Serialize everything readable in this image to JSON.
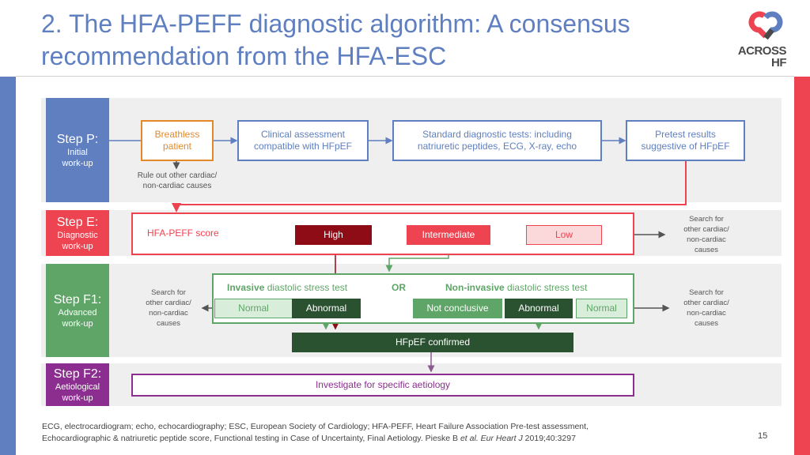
{
  "title": {
    "line1": "2. The HFA-PEFF diagnostic algorithm: A consensus",
    "line2": "recommendation from the HFA-ESC"
  },
  "logo": {
    "line1": "ACROSS",
    "line2": "HF",
    "icon": "heart-loop-logo-icon"
  },
  "colors": {
    "step_p": "#5f7fc1",
    "step_e": "#ee4350",
    "step_f1": "#5ea567",
    "step_f2": "#8b2e8f",
    "orange": "#e28a2a",
    "dark_red": "#8e0c15",
    "dark_green": "#2a5230",
    "light_green": "#d9eddb",
    "light_red": "#fbd8da"
  },
  "step_p": {
    "label": "Step P:",
    "sub1": "Initial",
    "sub2": "work-up",
    "boxes": [
      {
        "line1": "Breathless",
        "line2": "patient"
      },
      {
        "line1": "Clinical assessment",
        "line2": "compatible with HFpEF"
      },
      {
        "line1": "Standard diagnostic tests: including",
        "line2": "natriuretic peptides, ECG, X-ray, echo"
      },
      {
        "line1": "Pretest results",
        "line2": "suggestive of HFpEF"
      }
    ],
    "note_line1": "Rule out other cardiac/",
    "note_line2": "non-cardiac causes"
  },
  "step_e": {
    "label": "Step E:",
    "sub1": "Diagnostic",
    "sub2": "work-up",
    "score_label": "HFA-PEFF score",
    "high": "High",
    "intermediate": "Intermediate",
    "low": "Low",
    "note": [
      "Search for",
      "other cardiac/",
      "non-cardiac",
      "causes"
    ]
  },
  "step_f1": {
    "label": "Step F1:",
    "sub1": "Advanced",
    "sub2": "work-up",
    "invasive_bold": "Invasive",
    "invasive_rest": " diastolic stress test",
    "or": "OR",
    "noninvasive_bold": "Non-invasive",
    "noninvasive_rest": " diastolic stress test",
    "inv_normal": "Normal",
    "inv_abnormal": "Abnormal",
    "ni_not_conclusive": "Not conclusive",
    "ni_abnormal": "Abnormal",
    "ni_normal": "Normal",
    "confirmed": "HFpEF confirmed",
    "left_note": [
      "Search for",
      "other cardiac/",
      "non-cardiac",
      "causes"
    ],
    "right_note": [
      "Search for",
      "other cardiac/",
      "non-cardiac",
      "causes"
    ]
  },
  "step_f2": {
    "label": "Step F2:",
    "sub1": "Aetiological",
    "sub2": "work-up",
    "box": "Investigate for specific aetiology"
  },
  "footer": {
    "line1": "ECG, electrocardiogram; echo, echocardiography; ESC, European Society of Cardiology; HFA-PEFF, Heart Failure Association Pre-test assessment,",
    "line2_pre": "Echocardiographic & natriuretic peptide score, Functional testing in Case of Uncertainty, Final Aetiology. Pieske B ",
    "line2_etal": "et al.",
    "line2_mid": " ",
    "line2_journal": "Eur Heart J",
    "line2_post": " 2019;40:3297"
  },
  "page_number": "15"
}
